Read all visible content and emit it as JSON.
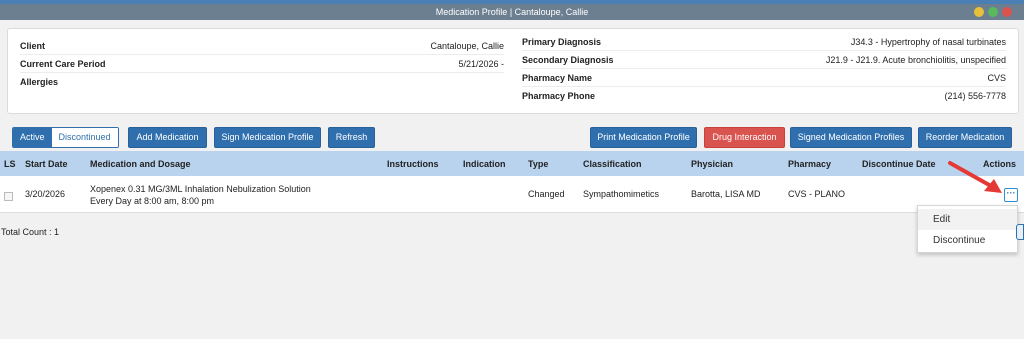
{
  "window": {
    "title": "Medication Profile | Cantaloupe, Callie"
  },
  "client_info": {
    "client_label": "Client",
    "client_value": "Cantaloupe, Callie",
    "care_period_label": "Current Care Period",
    "care_period_value": "5/21/2026 -",
    "allergies_label": "Allergies",
    "allergies_value": ""
  },
  "diagnosis_info": {
    "primary_label": "Primary Diagnosis",
    "primary_value": "J34.3 - Hypertrophy of nasal turbinates",
    "secondary_label": "Secondary Diagnosis",
    "secondary_value": "J21.9 - J21.9. Acute bronchiolitis, unspecified",
    "pharmacy_name_label": "Pharmacy Name",
    "pharmacy_name_value": "CVS",
    "pharmacy_phone_label": "Pharmacy Phone",
    "pharmacy_phone_value": "(214) 556-7778"
  },
  "toolbar": {
    "active": "Active",
    "discontinued": "Discontinued",
    "add": "Add Medication",
    "sign": "Sign Medication Profile",
    "refresh": "Refresh",
    "print": "Print Medication Profile",
    "drug": "Drug Interaction",
    "signed": "Signed Medication Profiles",
    "reorder": "Reorder Medication"
  },
  "table": {
    "headers": {
      "ls": "LS",
      "start": "Start Date",
      "med": "Medication and Dosage",
      "instr": "Instructions",
      "indic": "Indication",
      "type": "Type",
      "class": "Classification",
      "phys": "Physician",
      "pharm": "Pharmacy",
      "disc": "Discontinue Date",
      "actions": "Actions"
    },
    "row": {
      "start": "3/20/2026",
      "med_line1": "Xopenex 0.31 MG/3ML Inhalation Nebulization Solution",
      "med_line2": "Every Day at 8:00 am, 8:00 pm",
      "type": "Changed",
      "class": "Sympathomimetics",
      "phys": "Barotta, LISA MD",
      "pharm": "CVS - PLANO",
      "actions_icon": "ellipsis-icon"
    }
  },
  "actions_menu": {
    "edit": "Edit",
    "discontinue": "Discontinue"
  },
  "footer": {
    "total": "Total Count : 1"
  },
  "colors": {
    "primary": "#2f6fae",
    "danger": "#d9534f",
    "header_bg": "#b9d3ee",
    "titlebar": "#6b7f91",
    "arrow": "#e53935"
  }
}
